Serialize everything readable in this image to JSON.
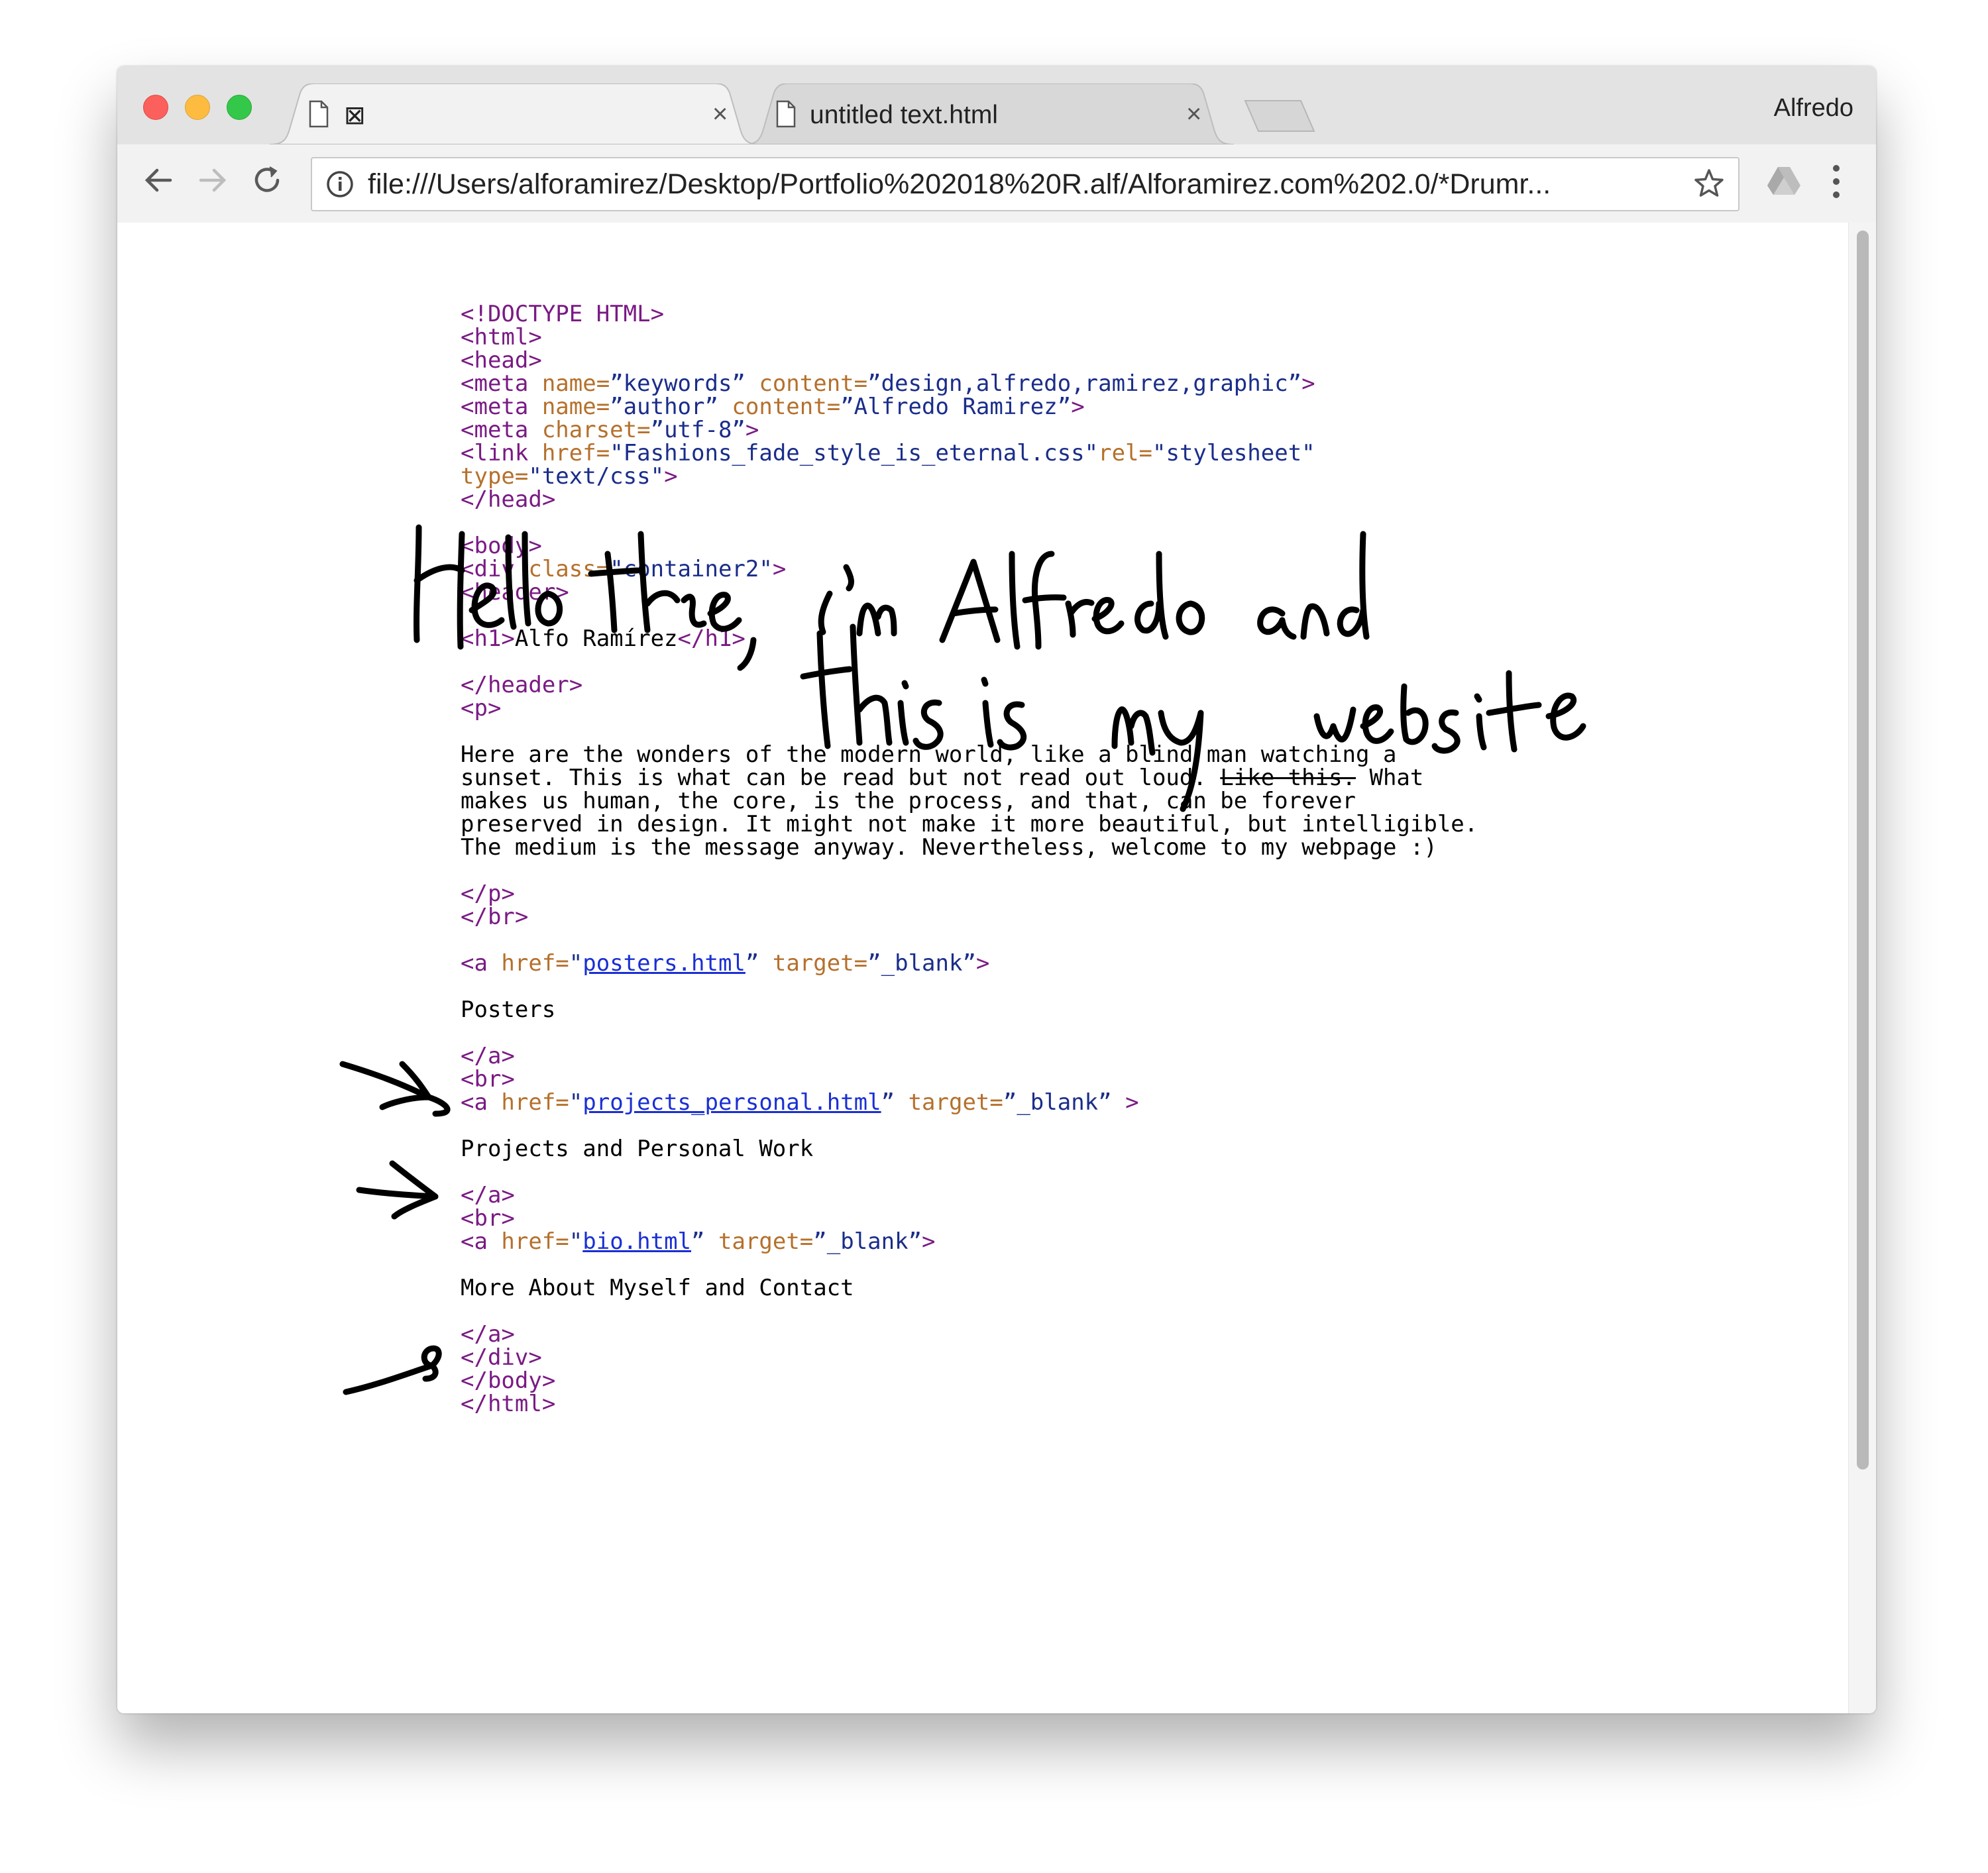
{
  "window": {
    "profile_name": "Alfredo"
  },
  "tabs": [
    {
      "label": "⊠",
      "close": "×",
      "active": true
    },
    {
      "label": "untitled text.html",
      "close": "×",
      "active": false
    }
  ],
  "toolbar": {
    "url": "file:///Users/alforamirez/Desktop/Portfolio%202018%20R.alf/Alforamirez.com%202.0/*Drumr..."
  },
  "colors": {
    "tag": "#7a1a84",
    "attribute": "#b5702c",
    "value": "#1a2d8a",
    "link": "#1a2fd4",
    "handwriting": "#000000"
  },
  "code": {
    "doctype": "<!DOCTYPE HTML>",
    "html_open": "<html>",
    "head_open": "<head>",
    "meta1": {
      "open": "<meta ",
      "name_attr": "name=",
      "name_val": "”keywords” ",
      "content_attr": "content=",
      "content_val": "”design,alfredo,ramirez,graphic”",
      "close": ">"
    },
    "meta2": {
      "open": "<meta ",
      "name_attr": "name=",
      "name_val": "”author” ",
      "content_attr": "content=",
      "content_val": "”Alfredo Ramirez”",
      "close": ">"
    },
    "meta3": {
      "open": "<meta ",
      "charset_attr": "charset=",
      "charset_val": "”utf-8”",
      "close": ">"
    },
    "link": {
      "open": "<link ",
      "href_attr": "href=",
      "href_val": "\"Fashions_fade_style_is_eternal.css\"",
      "rel_attr": "rel=",
      "rel_val": "\"stylesheet\""
    },
    "link_type": {
      "type_attr": "type=",
      "type_val": "\"text/css\"",
      "close": ">"
    },
    "head_close": "</head>",
    "body_open": "<body>",
    "div": {
      "open": "<div ",
      "class_attr": "class=",
      "class_val": "\"container2\"",
      "close": ">"
    },
    "header_open": "<header>",
    "h1": {
      "open": "<h1>",
      "text": "Alfo Ramírez",
      "close": "</h1>"
    },
    "header_close": "</header>",
    "p_open": "<p>",
    "paragraph": {
      "l1": "Here are the wonders of the modern world, like a blind man watching a",
      "l2a": "sunset. This is what can be read but not read out loud. ",
      "l2_strike": "Like this.",
      "l2b": " What",
      "l3": "makes us human, the core, is the process, and that, can be forever",
      "l4": "preserved in design. It might not make it more beautiful, but intelligible.",
      "l5": "The medium is the message anyway. Nevertheless, welcome to my webpage :)"
    },
    "p_close": "</p>",
    "br_close": "</br>",
    "a1": {
      "open": "<a ",
      "href_attr": "href=",
      "q1": "\"",
      "href": "posters.html",
      "q2": "” ",
      "target_attr": "target=",
      "target_val": "”_blank”",
      "close": ">",
      "text": "Posters"
    },
    "a_close": "</a>",
    "br": "<br>",
    "a2": {
      "open": "<a ",
      "href_attr": "href=",
      "q1": "\"",
      "href": "projects_personal.html",
      "q2": "” ",
      "target_attr": "target=",
      "target_val": "”_blank” ",
      "close": ">",
      "text": "Projects and Personal Work"
    },
    "a3": {
      "open": "<a ",
      "href_attr": "href=",
      "q1": "\"",
      "href": "bio.html",
      "q2": "” ",
      "target_attr": "target=",
      "target_val": "”_blank”",
      "close": ">",
      "text": "More About Myself and Contact"
    },
    "div_close": "</div>",
    "body_close": "</body>",
    "html_close": "</html>"
  },
  "handwriting": {
    "line1": "Hello there, I'm Alfredo and",
    "line2": "this is my website"
  }
}
